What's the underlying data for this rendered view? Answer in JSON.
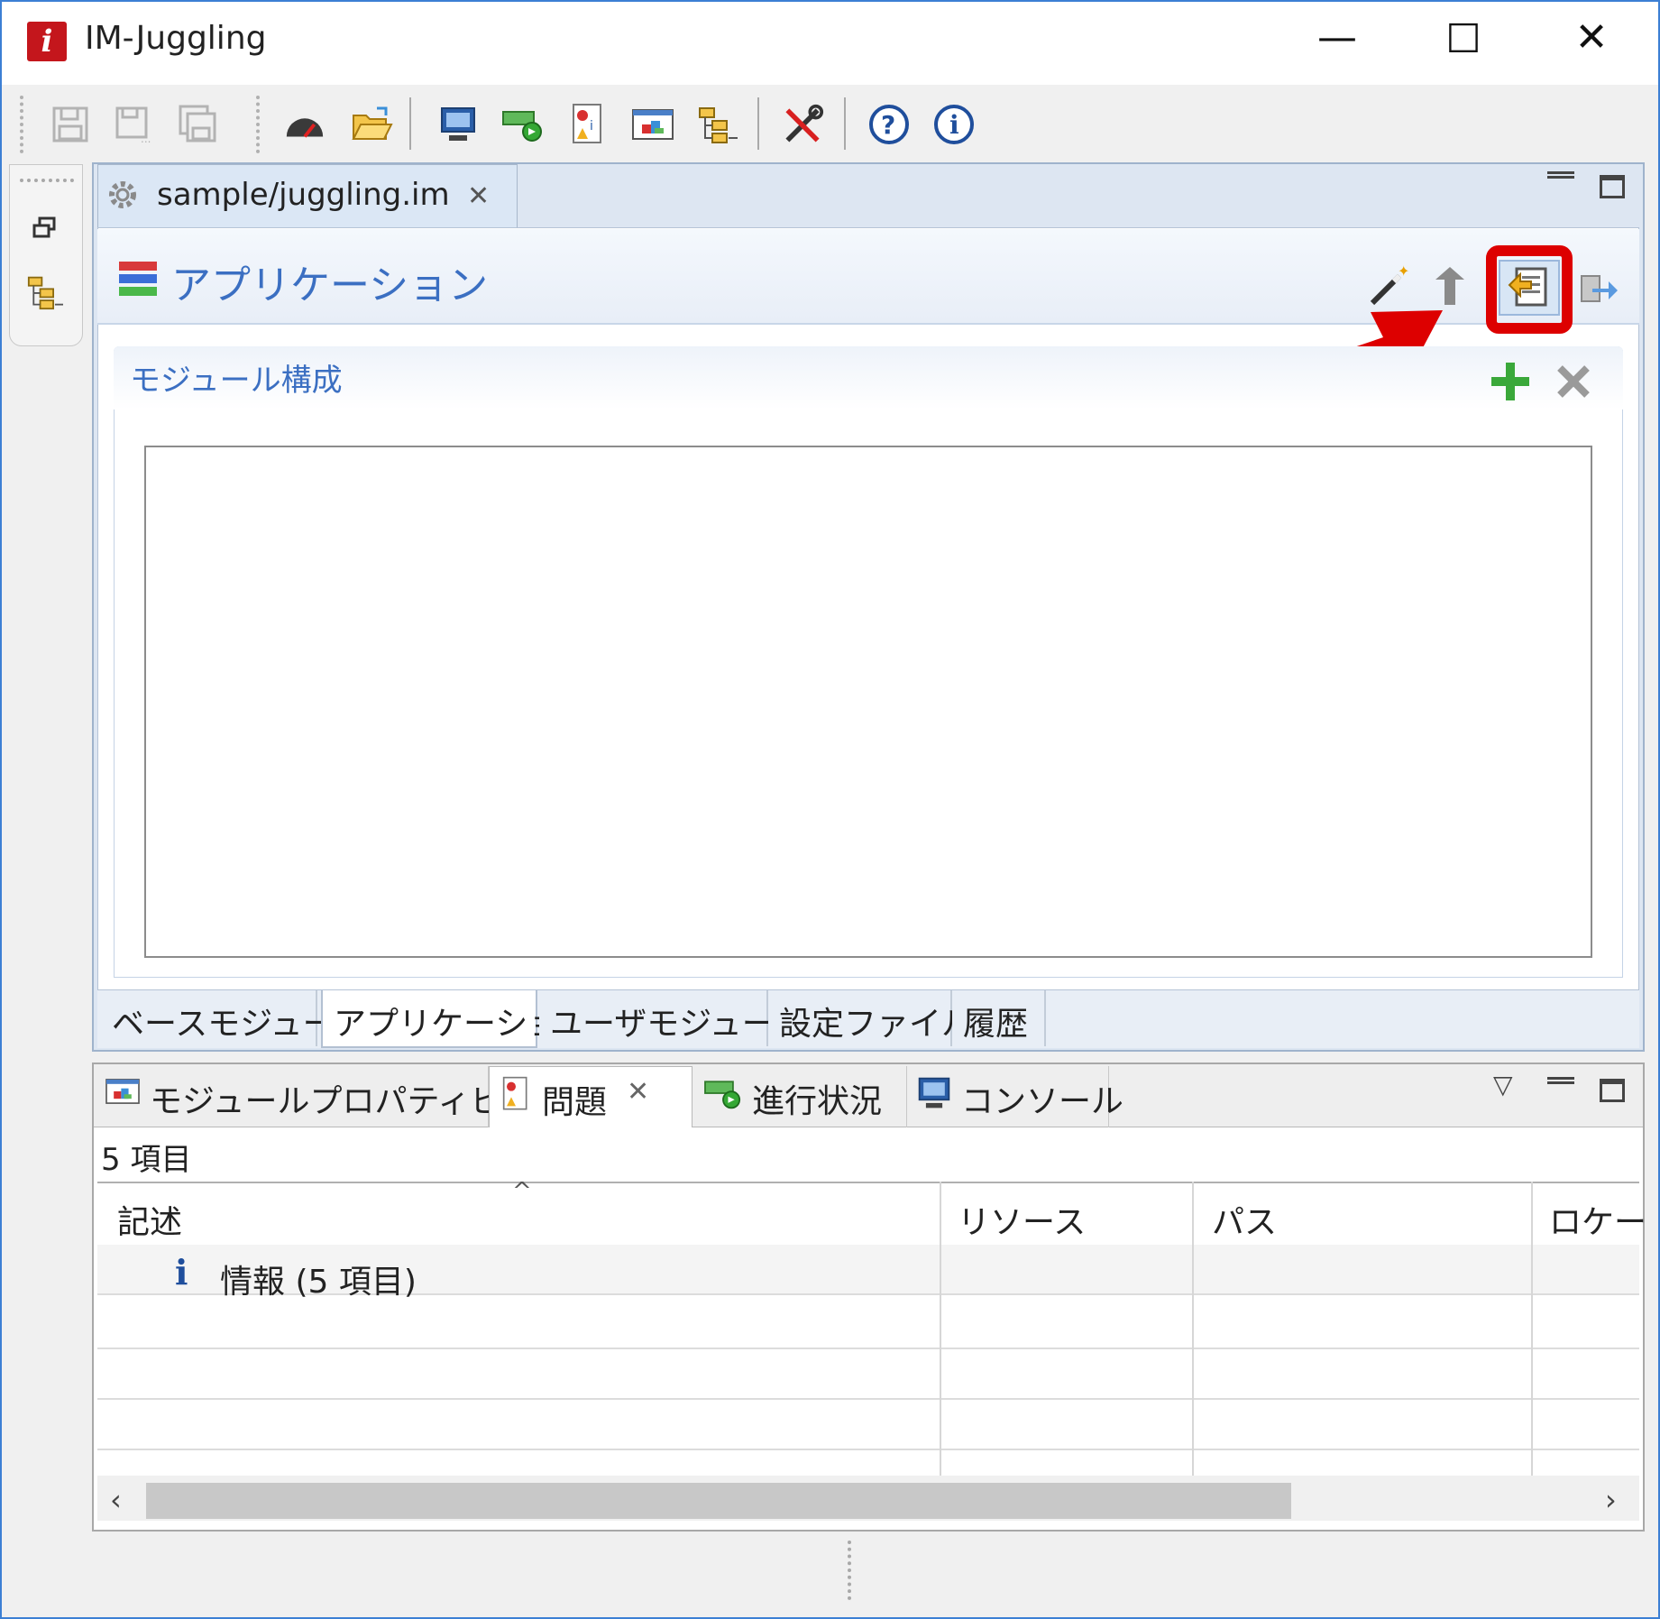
{
  "app": {
    "title": "IM-Juggling"
  },
  "editor": {
    "tab_label": "sample/juggling.im",
    "form_title": "アプリケーション",
    "section_title": "モジュール構成",
    "page_tabs": [
      "ベースモジュール",
      "アプリケーション",
      "ユーザモジュール",
      "設定ファイル",
      "履歴"
    ],
    "active_page_tab": "アプリケーション"
  },
  "bottom": {
    "tabs": [
      "モジュールプロパティビュー",
      "問題",
      "進行状況",
      "コンソール"
    ],
    "active_tab": "問題",
    "item_count": "5 項目",
    "columns": [
      "記述",
      "リソース",
      "パス",
      "ロケーシ"
    ],
    "rows": [
      {
        "description": "情報 (5 項目)",
        "icon": "info-icon"
      }
    ]
  },
  "annotation": {
    "highlight_color": "#dd0000",
    "target": "export-icon"
  },
  "icons": {
    "toolbar": [
      "save-icon",
      "save-as-icon",
      "save-all-icon",
      "speedometer-icon",
      "open-folder-icon",
      "monitor-icon",
      "progress-icon",
      "problems-icon",
      "module-property-icon",
      "tree-icon",
      "tools-icon",
      "help-icon",
      "about-icon"
    ],
    "form": [
      "wand-icon",
      "import-icon",
      "export-icon",
      "deploy-icon"
    ]
  }
}
